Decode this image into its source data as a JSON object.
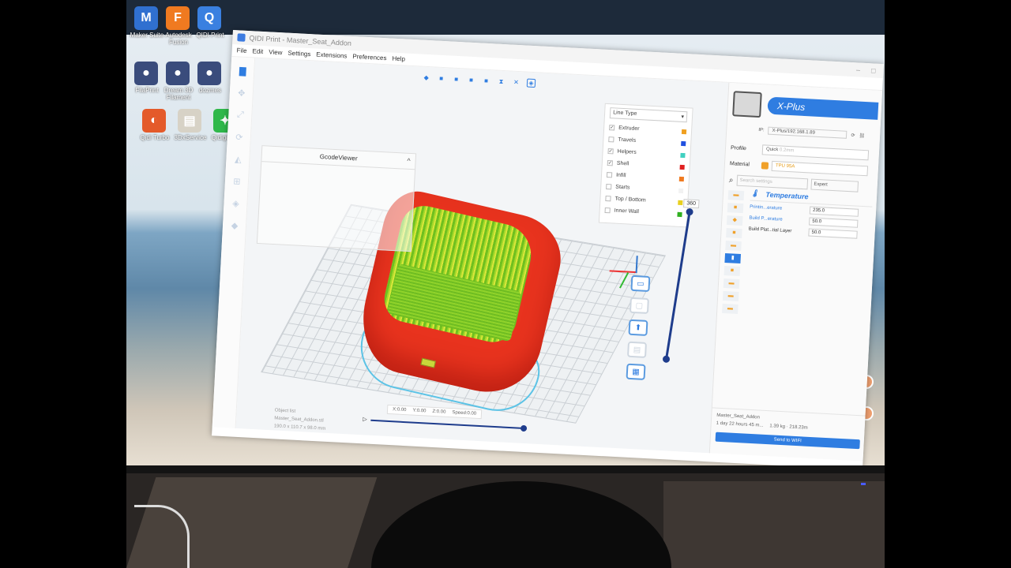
{
  "window": {
    "title": "QIDI Print - Master_Seat_Addon"
  },
  "menu": [
    "File",
    "Edit",
    "View",
    "Settings",
    "Extensions",
    "Preferences",
    "Help"
  ],
  "desktop_icons": [
    {
      "label": "Maker Suite",
      "glyph": "M",
      "color": "#3070d0"
    },
    {
      "label": "Autodesk Fusion",
      "glyph": "F",
      "color": "#f07a20"
    },
    {
      "label": "QIDI Print",
      "glyph": "Q",
      "color": "#3a80e0"
    },
    {
      "label": "FilaPrint",
      "glyph": "●",
      "color": "#3a4c7c"
    },
    {
      "label": "Dream 3D Filament",
      "glyph": "●",
      "color": "#3a4c7c"
    },
    {
      "label": "dozmes",
      "glyph": "●",
      "color": "#3a4c7c"
    },
    {
      "label": "Qidi Turbo",
      "glyph": "◐",
      "color": "#e45a2a"
    },
    {
      "label": "3DxService",
      "glyph": "▤",
      "color": "#d7d2c6"
    },
    {
      "label": "Qidigo Vid",
      "glyph": "✦",
      "color": "#2fb84a"
    }
  ],
  "gcode_viewer": {
    "title": "GcodeViewer"
  },
  "line_type": {
    "selector": "Line Type",
    "rows": [
      {
        "label": "Extruder",
        "color": "#f0a020",
        "checked": true
      },
      {
        "label": "Travels",
        "color": "#2050e0",
        "checked": false
      },
      {
        "label": "Helpers",
        "color": "#40d0c0",
        "checked": true
      },
      {
        "label": "Shell",
        "color": "#e02020",
        "checked": true
      },
      {
        "label": "Infill",
        "color": "#f07a20",
        "checked": false
      },
      {
        "label": "Starts",
        "color": "#f2f2f2",
        "checked": false
      },
      {
        "label": "Top / Bottom",
        "color": "#e8d020",
        "checked": false
      },
      {
        "label": "Inner Wall",
        "color": "#30b020",
        "checked": false
      }
    ]
  },
  "layer_slider": {
    "label": "360",
    "progress": 1.0
  },
  "object_status": {
    "line1": "Object list",
    "line2": "Master_Seat_Addon.stl",
    "line3": "190.0 x 110.7 x 98.0 mm"
  },
  "coords": {
    "x": "X:0.00",
    "y": "Y:0.00",
    "z": "Z:0.00",
    "speed": "Speed:0.00"
  },
  "printer": {
    "name": "X-Plus",
    "ip_label": "IP:",
    "ip_value": "X-Plus/192.168.1.89"
  },
  "profile": {
    "label": "Profile",
    "value": "Quick",
    "value_muted": "0.2mm"
  },
  "material": {
    "label": "Material",
    "value": "TPU 95A",
    "color": "#f0a12a"
  },
  "settings": {
    "search_placeholder": "Search settings",
    "mode": "Expert",
    "section_title": "Temperature",
    "rows": [
      {
        "name": "Printin...erature",
        "value": "235.0",
        "highlight": true
      },
      {
        "name": "Build P...erature",
        "value": "50.0",
        "highlight": true
      },
      {
        "name": "Build Plat...tial Layer",
        "value": "50.0",
        "highlight": false
      }
    ]
  },
  "footer": {
    "file": "Master_Seat_Addon",
    "time": "1 day 22 hours 45 m...",
    "weight": "1.39 kg · 218.23m",
    "send_button": "Send to WIFI"
  }
}
